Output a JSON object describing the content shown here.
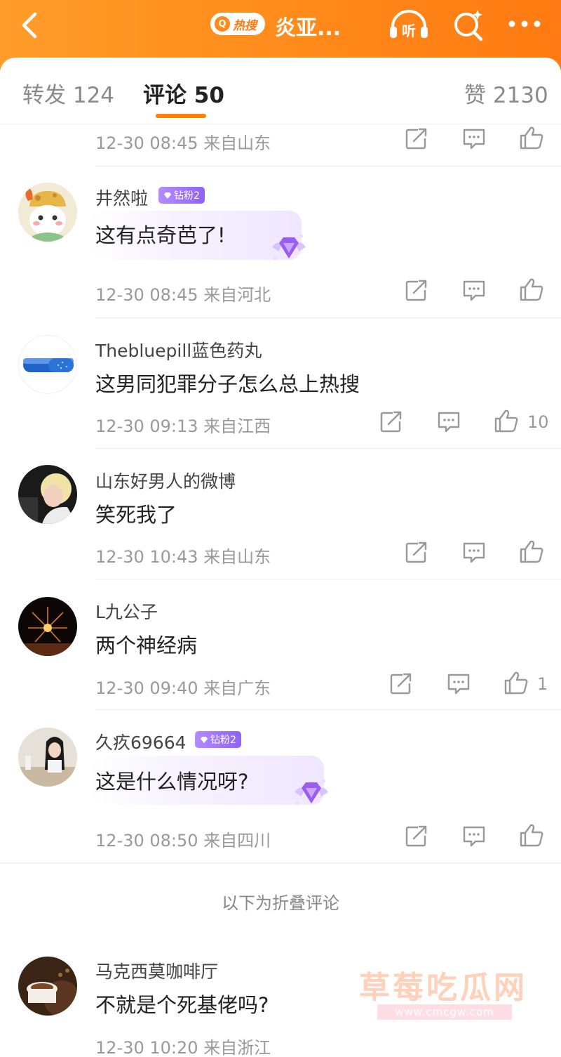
{
  "topbar": {
    "hot_badge_icon": "Q",
    "hot_badge_label": "热搜",
    "title": "炎亚...",
    "listen_label": "听",
    "background_color": "#ff8a1a"
  },
  "tabs": {
    "repost": "转发 124",
    "comments": "评论 50",
    "likes": "赞 2130",
    "accent_color": "#ff8200"
  },
  "comments": [
    {
      "meta": "12-30 08:45 来自山东"
    },
    {
      "username": "井然啦",
      "badge": "钻粉2",
      "text": "这有点奇芭了!",
      "meta": "12-30 08:45 来自河北"
    },
    {
      "username": "Thebluepill蓝色药丸",
      "text": "这男同犯罪分子怎么总上热搜",
      "meta": "12-30 09:13 来自江西",
      "likes": "10"
    },
    {
      "username": "山东好男人的微博",
      "text": "笑死我了",
      "meta": "12-30 10:43 来自山东"
    },
    {
      "username": "L九公子",
      "text": "两个神经病",
      "meta": "12-30 09:40 来自广东",
      "likes": "1"
    },
    {
      "username": "久疚69664",
      "badge": "钻粉2",
      "text": "这是什么情况呀?",
      "meta": "12-30 08:50 来自四川"
    },
    {
      "username": "马克西莫咖啡厅",
      "text": "不就是个死基佬吗?",
      "meta": "12-30 10:20 来自浙江"
    }
  ],
  "folded_label": "以下为折叠评论",
  "watermark": {
    "title": "草莓吃瓜网",
    "url": "www.cmcgw.com"
  }
}
